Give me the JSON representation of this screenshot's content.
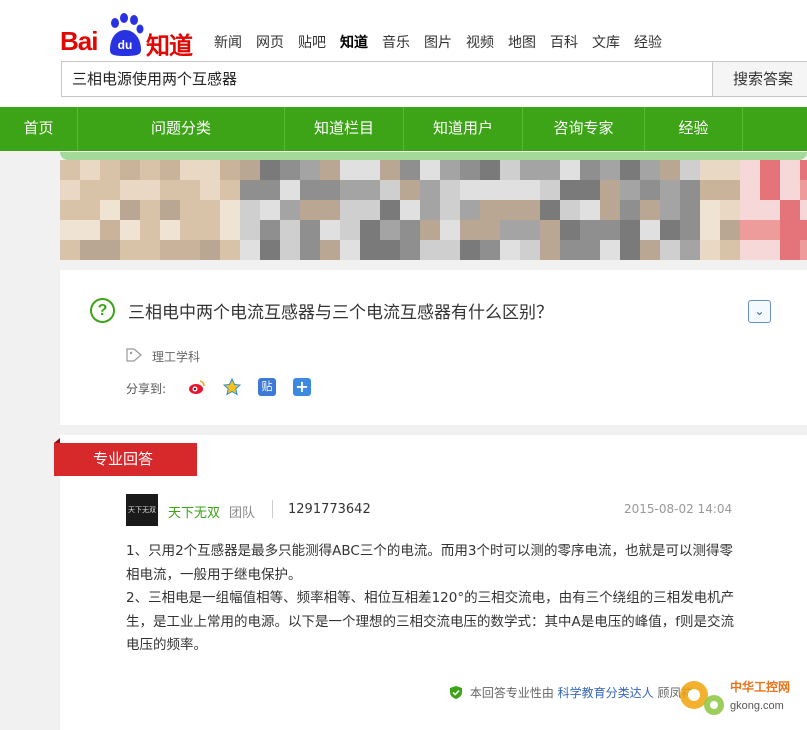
{
  "header": {
    "logo": {
      "bai": "Bai",
      "du": "du",
      "zhidao": "知道"
    },
    "nav": [
      "新闻",
      "网页",
      "贴吧",
      "知道",
      "音乐",
      "图片",
      "视频",
      "地图",
      "百科",
      "文库",
      "经验"
    ],
    "active_nav": "知道",
    "search_value": "三相电源使用两个互感器",
    "search_button": "搜索答案"
  },
  "greennav": [
    "首页",
    "问题分类",
    "知道栏目",
    "知道用户",
    "咨询专家",
    "经验"
  ],
  "colors": {
    "green": "#3da418",
    "red": "#d7282b",
    "brand_red": "#e10601",
    "link": "#3466b8"
  },
  "question": {
    "title": "三相电中两个电流互感器与三个电流互感器有什么区别？",
    "toggle_icon": "chevron-down-icon",
    "tag": "理工学科",
    "share_label": "分享到:",
    "share_icons": [
      "weibo-icon",
      "qzone-icon",
      "tieba-icon",
      "more-share-icon"
    ]
  },
  "answer": {
    "ribbon": "专业回答",
    "avatar_text": "天下无双",
    "user": "天下无双",
    "team": "团队",
    "user_id": "1291773642",
    "date": "2015-08-02 14:04",
    "paragraphs": [
      "1、只用2个互感器是最多只能测得ABC三个的电流。而用3个时可以测的零序电流，也就是可以测得零相电流，一般用于继电保护。",
      "2、三相电是一组幅值相等、频率相等、相位互相差120°的三相交流电，由有三个绕组的三相发电机产生，是工业上常用的电源。以下是一个理想的三相交流电压的数学式：其中A是电压的峰值，f则是交流电压的频率。"
    ],
    "footer_prefix": "本回答专业性由",
    "footer_link": "科学教育分类达人",
    "footer_suffix": "顾凤祥"
  },
  "watermark": {
    "name": "中华工控网",
    "domain": "gkong.com"
  }
}
